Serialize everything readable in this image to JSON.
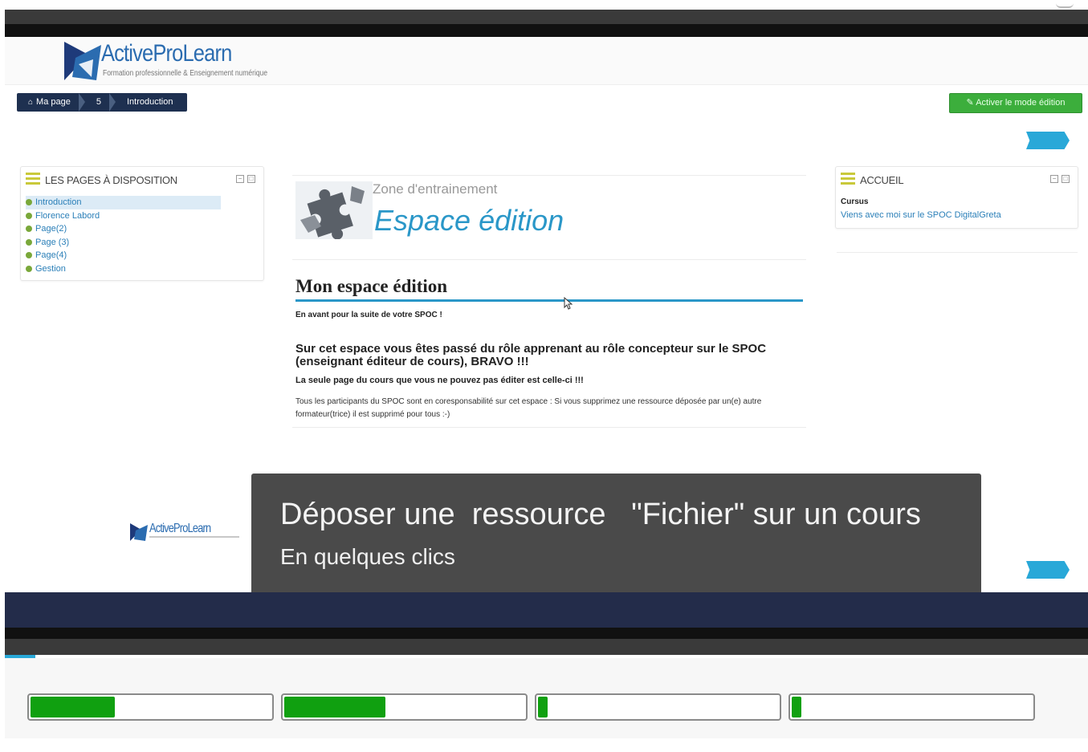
{
  "header": {
    "logo_title": "ActiveProLearn",
    "logo_subtitle": "Formation professionnelle & Enseignement numérique"
  },
  "breadcrumb": [
    "Ma page",
    "5",
    "Introduction"
  ],
  "edit_button": "Activer le mode édition",
  "left_block": {
    "title": "LES PAGES À DISPOSITION",
    "items": [
      "Introduction",
      "Florence Labord",
      "Page(2)",
      "Page (3)",
      "Page(4)",
      "Gestion"
    ],
    "active_index": 0
  },
  "right_block": {
    "title": "ACCUEIL",
    "subtitle": "Cursus",
    "link": "Viens avec moi sur le SPOC DigitalGreta"
  },
  "main": {
    "zone": "Zone d'entrainement",
    "heading": "Espace édition",
    "section_title": "Mon espace édition",
    "p1": "En avant pour la suite de  votre SPOC !",
    "p2": "Sur cet espace vous êtes passé  du rôle apprenant au rôle concepteur sur le SPOC (enseignant éditeur de cours), BRAVO !!!",
    "p3": "La seule page du cours que vous ne pouvez pas éditer est celle-ci !!!",
    "p4": "Tous les participants du SPOC sont  en coresponsabilité sur cet espace : Si vous supprimez une ressource déposée par un(e) autre formateur(trice) il est supprimé pour tous :-)"
  },
  "overlay": {
    "title": "Déposer une  ressource   \"Fichier\" sur un cours",
    "subtitle": "En quelques clics"
  },
  "small_logo": "ActiveProLearn",
  "progress_bars": [
    0.35,
    0.42,
    0.04,
    0.04
  ],
  "colors": {
    "accent_blue": "#29a8d8",
    "edit_green": "#3cae3c",
    "progress_green": "#10a010",
    "breadcrumb_navy": "#1e3050",
    "overlay_gray": "#4a4a4a"
  }
}
